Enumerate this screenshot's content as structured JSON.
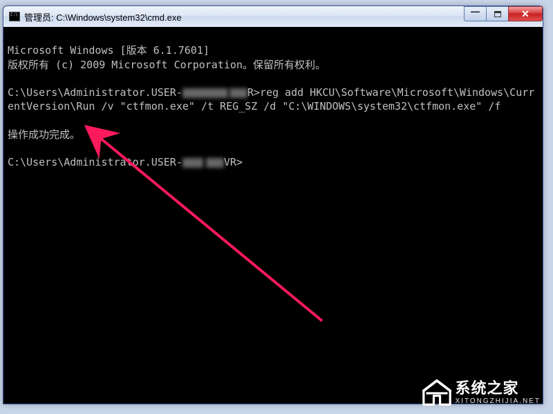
{
  "window": {
    "title": "管理员: C:\\Windows\\system32\\cmd.exe"
  },
  "terminal": {
    "line1": "Microsoft Windows [版本 6.1.7601]",
    "line2": "版权所有 (c) 2009 Microsoft Corporation。保留所有权利。",
    "prompt1_pre": "C:\\Users\\Administrator.USER-",
    "prompt1_post": "R>reg add HKCU\\Software\\Microsoft\\Windows\\CurrentVersion\\Run /v \"ctfmon.exe\" /t REG_SZ /d \"C:\\WINDOWS\\system32\\ctfmon.exe\" /f",
    "success": "操作成功完成。",
    "prompt2_pre": "C:\\Users\\Administrator.USER-",
    "prompt2_post": "VR>"
  },
  "watermark": {
    "main": "系统之家",
    "sub": "XITONGZHIJIA.NET"
  }
}
